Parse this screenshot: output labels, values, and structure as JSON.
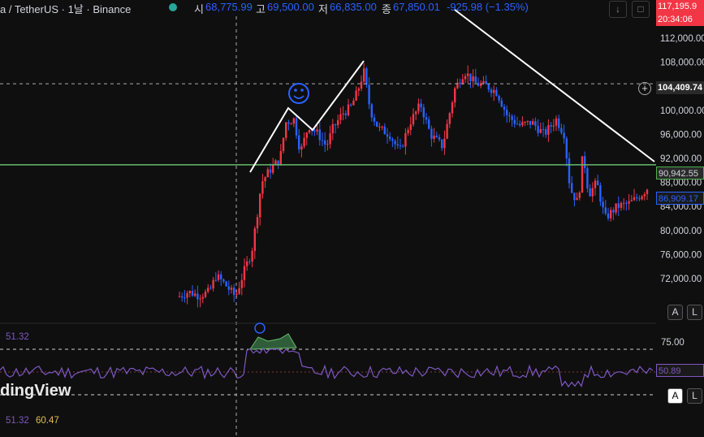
{
  "header": {
    "symbol": "a / TetherUS · 1날 · Binance",
    "open_label": "시",
    "open": "68,775.99",
    "high_label": "고",
    "high": "69,500.00",
    "low_label": "저",
    "low": "66,835.00",
    "close_label": "종",
    "close": "67,850.01",
    "change": "-925.98 (−1.35%)",
    "status_color": "#26a69a",
    "down_icon": "arrow-down-icon",
    "more_icon": "square-icon"
  },
  "price_tags": {
    "last": "117,195.9",
    "countdown": "20:34:06",
    "crosshair": "104,409.74",
    "green_line": "90,942.55",
    "blue": "86,909.17"
  },
  "price_axis": {
    "ticks": [
      "112,000.00",
      "108,000.00",
      "104,000.00",
      "100,000.00",
      "96,000.00",
      "92,000.00",
      "88,000.00",
      "84,000.00",
      "80,000.00",
      "76,000.00",
      "72,000.00"
    ],
    "a_button": "A",
    "l_button": "L"
  },
  "rsi": {
    "value_label": "51.32",
    "bottom_value_1": "51.32",
    "bottom_value_2": "60.47",
    "level_label": "75.00",
    "tag": "50.89",
    "a_button": "A",
    "l_button": "L",
    "brand": "dingView"
  },
  "chart_data": {
    "type": "candlestick",
    "y_range": [
      68000,
      114000
    ],
    "levels": {
      "support": 90942.55,
      "crosshair": 104409.74,
      "current": 86909.17
    },
    "upper_channel_price": 92000,
    "rsi_levels": [
      75,
      50,
      25
    ],
    "up_color": "#f23645",
    "down_color": "#2962ff",
    "emoji_marks": [
      "smiley-face"
    ],
    "grid": false
  }
}
